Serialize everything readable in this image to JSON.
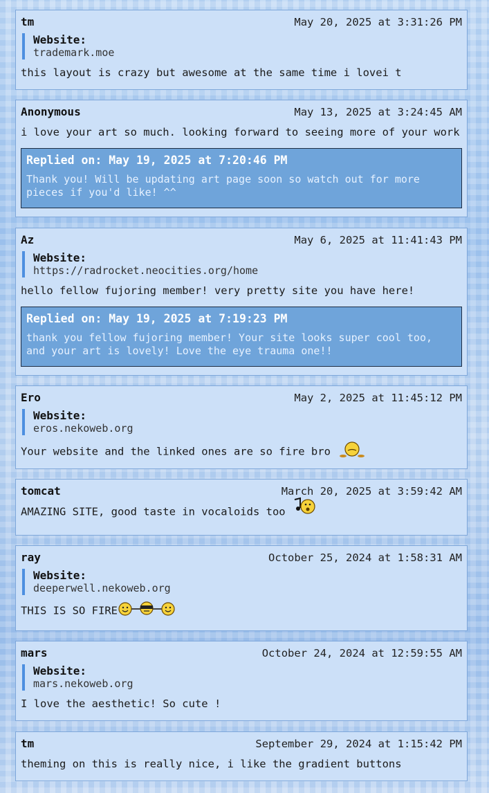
{
  "website_label": "Website:",
  "comments": [
    {
      "name": "tm",
      "date": "May 20, 2025 at 3:31:26 PM",
      "website": "trademark.moe",
      "text": "this layout is crazy but awesome at the same time i lovei t"
    },
    {
      "name": "Anonymous",
      "date": "May 13, 2025 at 3:24:45 AM",
      "text": "i love your art so much. looking forward to seeing more of your work",
      "reply": {
        "header": "Replied on: May 19, 2025 at 7:20:46 PM",
        "text": "Thank you! Will be updating art page soon so watch out for more pieces if you'd like! ^^"
      }
    },
    {
      "name": "Az",
      "date": "May 6, 2025 at 11:41:43 PM",
      "website": "https://radrocket.neocities.org/home",
      "text": "hello fellow fujoring member! very pretty site you have here!",
      "reply": {
        "header": "Replied on: May 19, 2025 at 7:19:23 PM",
        "text": "thank you fellow fujoring member! Your site looks super cool too, and your art is lovely! Love the eye trauma one!!"
      }
    },
    {
      "name": "Ero",
      "date": "May 2, 2025 at 11:45:12 PM",
      "website": "eros.nekoweb.org",
      "text": "Your website and the linked ones are so fire bro",
      "emoji": "sweating-smiley-icon"
    },
    {
      "name": "tomcat",
      "date": "March 20, 2025 at 3:59:42 AM",
      "text": "AMAZING SITE, good taste in vocaloids too",
      "emoji": "singing-smiley-icon"
    },
    {
      "name": "ray",
      "date": "October 25, 2024 at 1:58:31 AM",
      "website": "deeperwell.nekoweb.org",
      "text": "THIS IS SO FIRE",
      "emoji": "smiley-group-icon"
    },
    {
      "name": "mars",
      "date": "October 24, 2024 at 12:59:55 AM",
      "website": "mars.nekoweb.org",
      "text": "I love the aesthetic! So cute !"
    },
    {
      "name": "tm",
      "date": "September 29, 2024 at 1:15:42 PM",
      "text": "theming on this is really nice, i like the gradient buttons"
    }
  ]
}
